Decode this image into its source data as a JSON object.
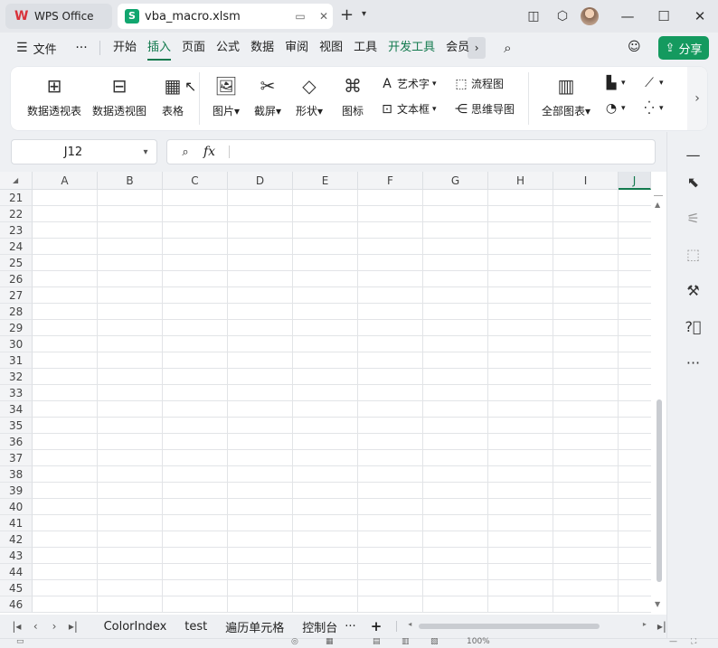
{
  "titlebar": {
    "app_tab": "WPS Office",
    "file_tab": "vba_macro.xlsm",
    "file_badge": "S",
    "icons": [
      "monitor-icon",
      "close-icon",
      "plus-icon",
      "chevron-down-icon",
      "layout-icon",
      "box-icon",
      "avatar",
      "minimize-icon",
      "maximize-icon",
      "close-icon"
    ]
  },
  "menubar": {
    "file_label": "文件",
    "items": [
      "开始",
      "插入",
      "页面",
      "公式",
      "数据",
      "审阅",
      "视图",
      "工具",
      "开发工具",
      "会员"
    ],
    "active": "插入",
    "share_label": "分享"
  },
  "ribbon": {
    "large": [
      {
        "label": "数据透视表"
      },
      {
        "label": "数据透视图"
      },
      {
        "label": "表格"
      },
      {
        "label": "图片"
      },
      {
        "label": "截屏"
      },
      {
        "label": "形状"
      },
      {
        "label": "图标"
      }
    ],
    "small": [
      {
        "label": "艺术字"
      },
      {
        "label": "文本框"
      },
      {
        "label": "流程图"
      },
      {
        "label": "思维导图"
      }
    ],
    "chart_all": "全部图表"
  },
  "formula": {
    "name_box": "J12",
    "fx_label": "fx",
    "value": ""
  },
  "grid": {
    "columns": [
      "A",
      "B",
      "C",
      "D",
      "E",
      "F",
      "G",
      "H",
      "I",
      "J"
    ],
    "selected_column": "J",
    "rows": [
      "21",
      "22",
      "23",
      "24",
      "25",
      "26",
      "27",
      "28",
      "29",
      "30",
      "31",
      "32",
      "33",
      "34",
      "35",
      "36",
      "37",
      "38",
      "39",
      "40",
      "41",
      "42",
      "43",
      "44",
      "45",
      "46"
    ]
  },
  "sheets": {
    "tabs": [
      "ColorIndex",
      "test",
      "遍历单元格",
      "控制台"
    ],
    "more": "···"
  },
  "status": {
    "zoom": "100%"
  }
}
